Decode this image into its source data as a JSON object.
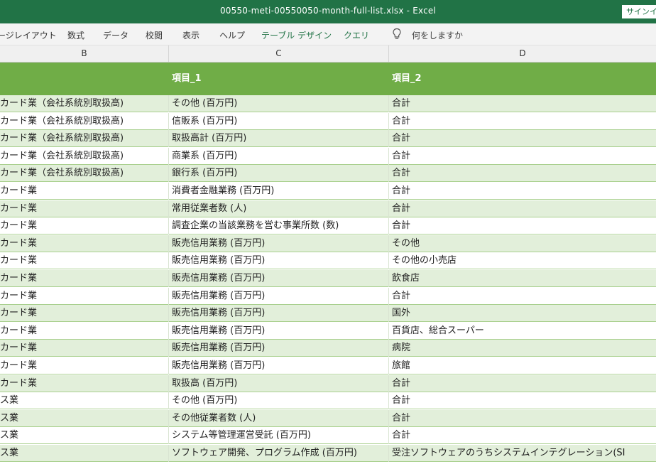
{
  "window": {
    "title": "00550-meti-00550050-month-full-list.xlsx  -  Excel",
    "signin_label": "サインイ"
  },
  "ribbon": {
    "tabs": [
      "ージレイアウト",
      "数式",
      "データ",
      "校閲",
      "表示",
      "ヘルプ",
      "テーブル デザイン",
      "クエリ"
    ],
    "tell_me": "何をしますか"
  },
  "columns": [
    "B",
    "C",
    "D"
  ],
  "table": {
    "header": [
      "",
      "項目_1",
      "項目_2"
    ],
    "rows": [
      [
        "カード業（会社系統別取扱高)",
        "その他 (百万円)",
        "合計"
      ],
      [
        "カード業（会社系統別取扱高)",
        "信販系 (百万円)",
        "合計"
      ],
      [
        "カード業（会社系統別取扱高)",
        "取扱高計 (百万円)",
        "合計"
      ],
      [
        "カード業（会社系統別取扱高)",
        "商業系 (百万円)",
        "合計"
      ],
      [
        "カード業（会社系統別取扱高)",
        "銀行系 (百万円)",
        "合計"
      ],
      [
        "カード業",
        "消費者金融業務 (百万円)",
        "合計"
      ],
      [
        "カード業",
        "常用従業者数 (人)",
        "合計"
      ],
      [
        "カード業",
        "調査企業の当該業務を営む事業所数 (数)",
        "合計"
      ],
      [
        "カード業",
        "販売信用業務 (百万円)",
        "その他"
      ],
      [
        "カード業",
        "販売信用業務 (百万円)",
        "その他の小売店"
      ],
      [
        "カード業",
        "販売信用業務 (百万円)",
        "飲食店"
      ],
      [
        "カード業",
        "販売信用業務 (百万円)",
        "合計"
      ],
      [
        "カード業",
        "販売信用業務 (百万円)",
        "国外"
      ],
      [
        "カード業",
        "販売信用業務 (百万円)",
        "百貨店、総合スーパー"
      ],
      [
        "カード業",
        "販売信用業務 (百万円)",
        "病院"
      ],
      [
        "カード業",
        "販売信用業務 (百万円)",
        "旅館"
      ],
      [
        "カード業",
        "取扱高 (百万円)",
        "合計"
      ],
      [
        "ス業",
        "その他 (百万円)",
        "合計"
      ],
      [
        "ス業",
        "その他従業者数 (人)",
        "合計"
      ],
      [
        "ス業",
        "システム等管理運営受託 (百万円)",
        "合計"
      ],
      [
        "ス業",
        "ソフトウェア開発、プログラム作成 (百万円)",
        "受注ソフトウェアのうちシステムインテグレーション(SI"
      ]
    ]
  }
}
